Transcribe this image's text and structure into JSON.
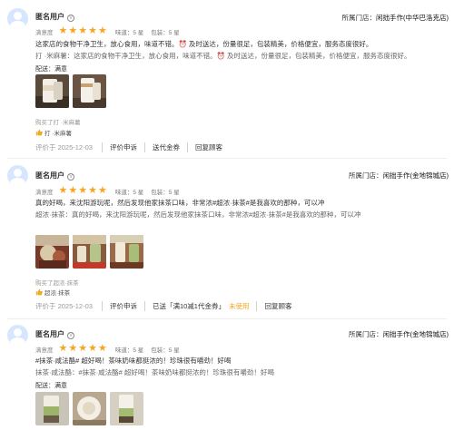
{
  "reviews": [
    {
      "username": "匿名用户",
      "verified_mark": "V",
      "store_label": "所属门店：",
      "store_name": "闲拙手作(中华巴洛克店)",
      "satisfaction_label": "满意度",
      "stars": 5,
      "taste": "味道：5 星",
      "packaging": "包装：5 星",
      "text": "这家店的食物干净卫生，放心食用，味道不错。⏰ 及时送达，份量很足，包装精美，价格便宜，服务态度很好。",
      "reply": "打 ·米麻薯：这家店的食物干净卫生，放心食用，味道不错。⏰ 及时送达，份量很足，包装精美，价格便宜，服务态度很好。",
      "delivery": "配送：满意",
      "bought": "购买了打 ·米麻薯",
      "product": "打 ·米麻薯",
      "date": "评价于 2025-12-03",
      "buttons": [
        "评价申诉",
        "送代金券",
        "回复顾客"
      ],
      "coupon_note": "",
      "coupon_status": ""
    },
    {
      "username": "匿名用户",
      "verified_mark": "V",
      "store_label": "所属门店：",
      "store_name": "闲拙手作(金地锦城店)",
      "satisfaction_label": "满意度",
      "stars": 5,
      "taste": "味道：5 星",
      "packaging": "包装：5 星",
      "text": "真的好喝，来沈阳游玩呢，然后发现他家抹茶口味，非常浓#超浓·抹茶#是我喜欢的那种，可以冲",
      "reply": "超浓·抹茶：真的好喝，来沈阳游玩呢，然后发现他家抹茶口味，非常浓#超浓·抹茶#是我喜欢的那种，可以冲",
      "delivery": "",
      "bought": "购买了超浓·抹茶",
      "product": "超浓·抹茶",
      "date": "评价于 2025-12-03",
      "buttons": [
        "评价申诉",
        "回复顾客"
      ],
      "coupon_note": "已送「满10减1代金券」",
      "coupon_status": "未使用"
    },
    {
      "username": "匿名用户",
      "verified_mark": "V",
      "store_label": "所属门店：",
      "store_name": "闲拙手作(金地锦城店)",
      "satisfaction_label": "满意度",
      "stars": 5,
      "taste": "味道：5 星",
      "packaging": "包装：5 星",
      "text": "#抹茶·咸法酪# 超好喝！茶味奶味都挺浓的！珍珠很有嚼劲！好喝",
      "reply": "抹茶·咸法酪：#抹茶·咸法酪# 超好喝！茶味奶味都挺浓的！珍珠很有嚼劲！好喝",
      "delivery": "配送：满意",
      "bought": "",
      "product": "",
      "date": "",
      "buttons": [],
      "coupon_note": "",
      "coupon_status": ""
    }
  ],
  "colors": {
    "star": "#f5a623",
    "avatar_bg": "#d7e6ff",
    "unused": "#f5a623",
    "divider": "#eeeeee"
  }
}
